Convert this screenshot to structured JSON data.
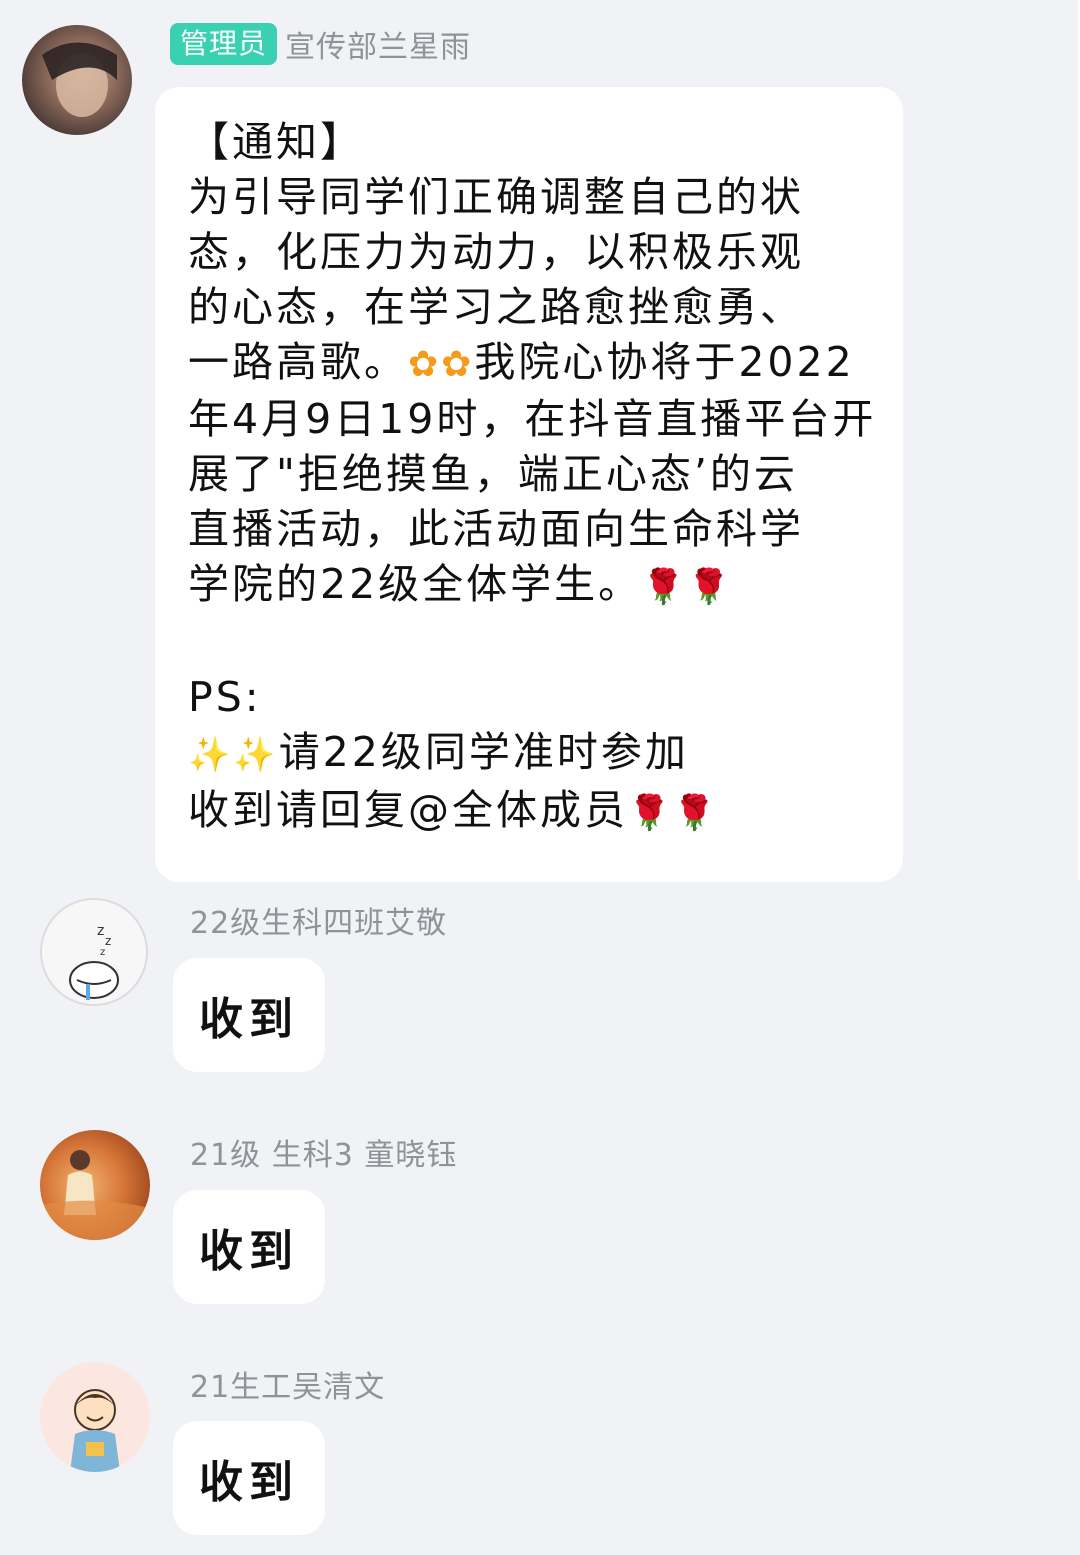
{
  "messages": [
    {
      "badge": "管理员",
      "sender": "宣传部兰星雨",
      "notice_lines": [
        "【通知】",
        "为引导同学们正确调整自己的状",
        "态，化压力为动力，以积极乐观",
        "的心态，在学习之路愈挫愈勇、",
        "一路高歌。",
        "我院心协将于2022",
        "年4月9日19时，在抖音直播平台开",
        "展了\"拒绝摸鱼，端正心态’的云",
        "直播活动，此活动面向生命科学",
        "学院的22级全体学生。",
        "PS:",
        "请22级同学准时参加",
        "收到请回复@全体成员"
      ],
      "emoji_flower": "flower-face-emoji",
      "emoji_rose": "rose-emoji",
      "emoji_sparkles": "sparkles-emoji"
    },
    {
      "sender": "22级生科四班艾敬",
      "text": "收到"
    },
    {
      "sender": "21级 生科3 童晓钰",
      "text": "收到"
    },
    {
      "sender": "21生工吴清文",
      "text": "收到"
    }
  ],
  "colors": {
    "background": "#f1f2f6",
    "bubble": "#ffffff",
    "admin_badge": "#3ad1b2",
    "sender_text": "#8f9297"
  }
}
